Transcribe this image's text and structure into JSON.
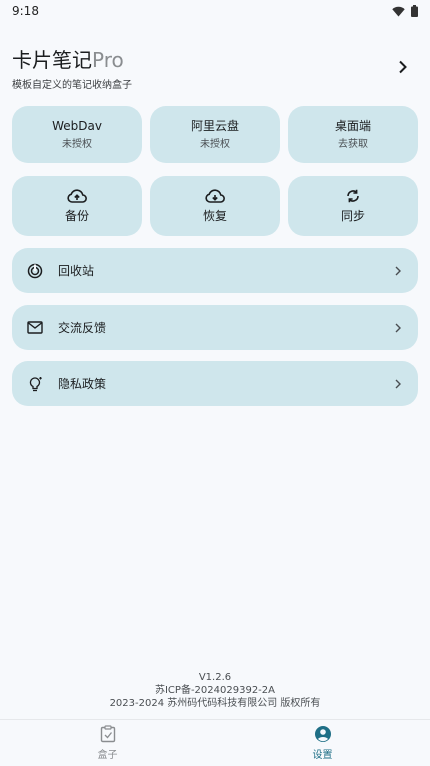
{
  "status_bar": {
    "time": "9:18"
  },
  "header": {
    "title": "卡片笔记",
    "title_suffix": "Pro",
    "subtitle": "模板自定义的笔记收纳盒子"
  },
  "sync_cards": [
    {
      "title": "WebDav",
      "status": "未授权"
    },
    {
      "title": "阿里云盘",
      "status": "未授权"
    },
    {
      "title": "桌面端",
      "status": "去获取"
    }
  ],
  "action_cards": [
    {
      "label": "备份",
      "icon": "cloud-upload-icon"
    },
    {
      "label": "恢复",
      "icon": "cloud-download-icon"
    },
    {
      "label": "同步",
      "icon": "sync-icon"
    }
  ],
  "menu": [
    {
      "label": "回收站",
      "icon": "recycle-icon"
    },
    {
      "label": "交流反馈",
      "icon": "mail-icon"
    },
    {
      "label": "隐私政策",
      "icon": "lightbulb-icon"
    }
  ],
  "footer": {
    "version": "V1.2.6",
    "icp": "苏ICP备-2024029392-2A",
    "copyright": "2023-2024 苏州码代码科技有限公司 版权所有"
  },
  "bottom_nav": [
    {
      "label": "盒子",
      "icon": "clipboard-icon",
      "active": false
    },
    {
      "label": "设置",
      "icon": "account-circle-icon",
      "active": true
    }
  ],
  "colors": {
    "card_bg": "#cfe6ec",
    "page_bg": "#f7f9fc",
    "accent": "#1f6f86"
  }
}
